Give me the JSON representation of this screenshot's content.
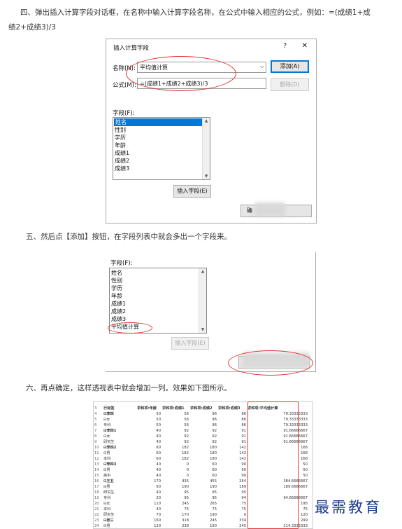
{
  "step4": {
    "line1": "四、弹出插入计算字段对话框，在名称中输入计算字段名称，在公式中输入相应的公式，例如：=(成绩1+成",
    "line2": "绩2+成绩3)/3"
  },
  "dialog": {
    "title": "插入计算字段",
    "help": "?",
    "close": "✕",
    "name_label": "名称(N):",
    "name_value": "平均值计算",
    "formula_label": "公式(M):",
    "formula_value": "=(成绩1+成绩2+成绩3)/3",
    "add_button": "添加(A)",
    "delete_button": "删除(D)",
    "fields_label": "字段(F):",
    "fields": [
      "姓名",
      "性别",
      "学历",
      "年龄",
      "成绩1",
      "成绩2",
      "成绩3"
    ],
    "insert_button": "插入字段(E)",
    "ok_button": "确"
  },
  "step5": {
    "text": "五、然后点【添加】按钮，在字段列表中就会多出一个字段来。"
  },
  "dialog2": {
    "fields_label": "字段(F):",
    "fields": [
      "姓名",
      "性别",
      "学历",
      "年龄",
      "成绩1",
      "成绩2",
      "成绩3",
      "平均值计算"
    ],
    "insert_button": "插入字段(E)"
  },
  "step6": {
    "text": "六、再点确定，这样透视表中就会增加一列。效果如下图所示。"
  },
  "sheet": {
    "headers": [
      "行标签",
      "求和项:年龄",
      "求和项:成绩1",
      "求和项:成绩2",
      "求和项:成绩3",
      "求和项:平均值计算"
    ],
    "rows": [
      {
        "n": "3",
        "c": [
          "行标签",
          "求和项:年龄",
          "求和项:成绩1",
          "求和项:成绩2",
          "求和项:成绩3",
          "求和项:平均值计算"
        ]
      },
      {
        "n": "4",
        "c": [
          "⊟李四",
          "50",
          "56",
          "96",
          "86",
          "79.33333333"
        ]
      },
      {
        "n": "5",
        "c": [
          "  ⊟女",
          "50",
          "56",
          "96",
          "86",
          "79.33333333"
        ]
      },
      {
        "n": "6",
        "c": [
          "      专科",
          "50",
          "56",
          "96",
          "86",
          "79.33333333"
        ]
      },
      {
        "n": "7",
        "c": [
          "⊟李四1",
          "40",
          "92",
          "92",
          "91",
          "91.66666667"
        ]
      },
      {
        "n": "8",
        "c": [
          "  ⊟女",
          "40",
          "92",
          "92",
          "91",
          "91.66666667"
        ]
      },
      {
        "n": "9",
        "c": [
          "      研究生",
          "40",
          "92",
          "92",
          "91",
          "91.66666667"
        ]
      },
      {
        "n": "10",
        "c": [
          "⊟李四2",
          "60",
          "182",
          "180",
          "142",
          "168"
        ]
      },
      {
        "n": "11",
        "c": [
          "  ⊟男",
          "60",
          "182",
          "180",
          "142",
          "168"
        ]
      },
      {
        "n": "12",
        "c": [
          "      本科",
          "60",
          "182",
          "180",
          "142",
          "168"
        ]
      },
      {
        "n": "13",
        "c": [
          "⊟李四3",
          "40",
          "0",
          "60",
          "90",
          "50"
        ]
      },
      {
        "n": "14",
        "c": [
          "  ⊟男",
          "40",
          "0",
          "60",
          "90",
          "50"
        ]
      },
      {
        "n": "15",
        "c": [
          "      高中",
          "40",
          "0",
          "60",
          "90",
          "50"
        ]
      },
      {
        "n": "16",
        "c": [
          "⊟王五",
          "170",
          "435",
          "455",
          "264",
          "384.6666667"
        ]
      },
      {
        "n": "17",
        "c": [
          "  ⊟男",
          "60",
          "190",
          "190",
          "189",
          "189.6666667"
        ]
      },
      {
        "n": "18",
        "c": [
          "      研究生",
          "40",
          "95",
          "95",
          "95",
          ""
        ]
      },
      {
        "n": "19",
        "c": [
          "      专科",
          "20",
          "95",
          "95",
          "94",
          "94.66666667"
        ]
      },
      {
        "n": "20",
        "c": [
          "  ⊟女",
          "110",
          "245",
          "265",
          "75",
          "195"
        ]
      },
      {
        "n": "21",
        "c": [
          "      本科",
          "40",
          "75",
          "75",
          "75",
          "75"
        ]
      },
      {
        "n": "22",
        "c": [
          "      研究生",
          "70",
          "170",
          "190",
          "0",
          "120"
        ]
      },
      {
        "n": "23",
        "c": [
          "⊟张三",
          "160",
          "318",
          "245",
          "334",
          "299"
        ]
      },
      {
        "n": "24",
        "c": [
          "  ⊟男",
          "120",
          "238",
          "160",
          "245",
          "214.3333333"
        ]
      }
    ]
  },
  "watermark": "最需教育"
}
